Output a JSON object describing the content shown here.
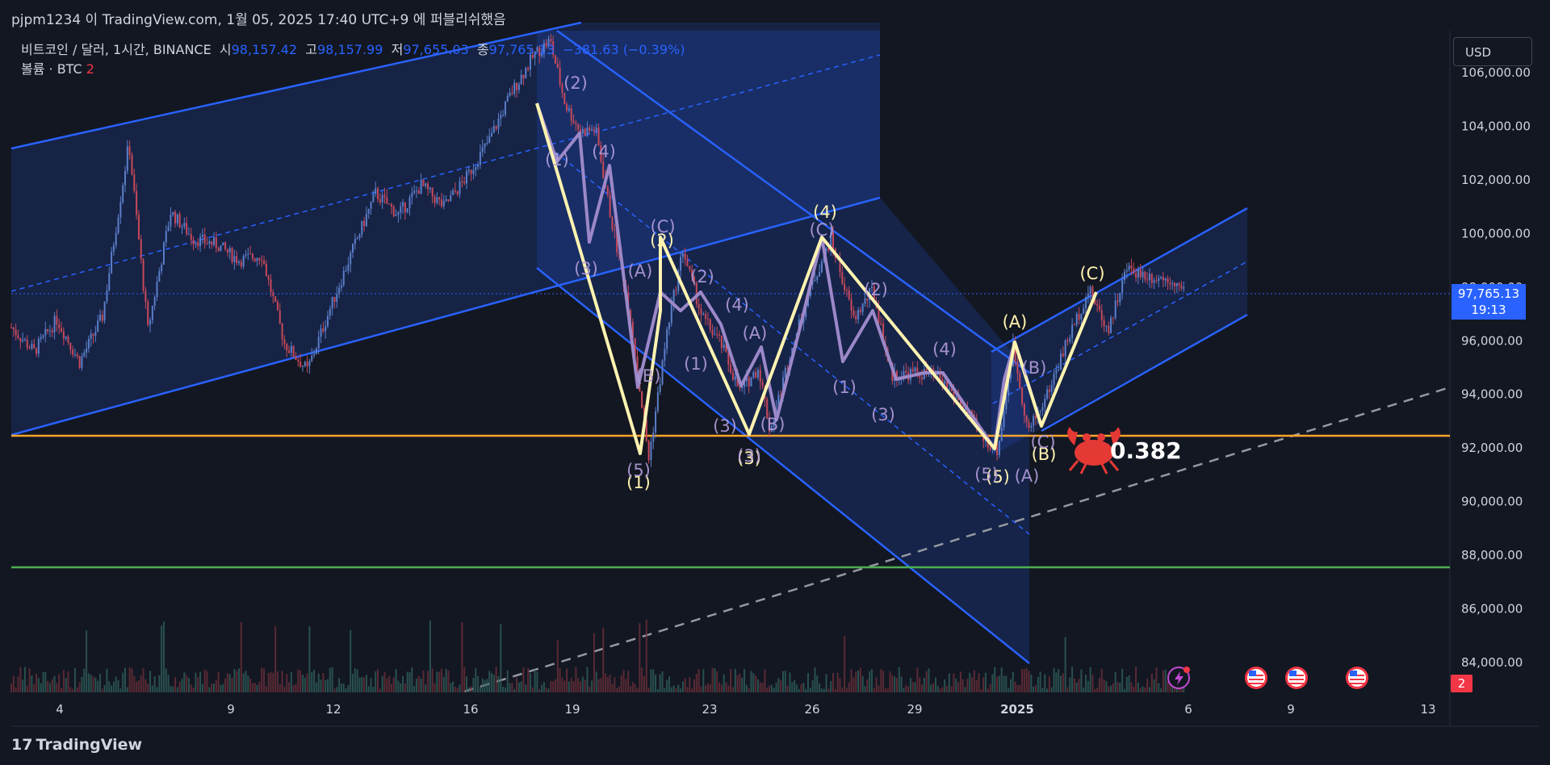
{
  "header": {
    "publish_text": "pjpm1234 이 TradingView.com, 1월 05, 2025 17:40 UTC+9 에 퍼블리쉬했음"
  },
  "legend": {
    "symbol": "비트코인 / 달러, 1시간, BINANCE",
    "open_label": "시",
    "open_value": "98,157.42",
    "high_label": "고",
    "high_value": "98,157.99",
    "low_label": "저",
    "low_value": "97,655.03",
    "close_label": "종",
    "close_value": "97,765.13",
    "change_value": "−381.63 (−0.39%)",
    "volume_label": "볼륨 · BTC",
    "volume_value": "2"
  },
  "currency": "USD",
  "price_tag": {
    "price": "97,765.13",
    "countdown": "19:13"
  },
  "events_count": "2",
  "annotation": {
    "ratio_text": "0.382",
    "crab_icon": "crab-icon"
  },
  "footer": {
    "brand": "TradingView"
  },
  "colors": {
    "background": "#131722",
    "channel_blue": "#2962ff",
    "support_orange": "#f7a42b",
    "support_green": "#4caf50",
    "wave_yellow": "#fff3b0",
    "wave_purple": "#9c88c8",
    "label_purple": "#b39ddb"
  },
  "chart_data": {
    "type": "candlestick",
    "symbol": "BTCUSD",
    "timeframe": "1h",
    "y_ticks": [
      "106,000.00",
      "104,000.00",
      "102,000.00",
      "100,000.00",
      "98,000.00",
      "96,000.00",
      "94,000.00",
      "92,000.00",
      "90,000.00",
      "88,000.00",
      "86,000.00",
      "84,000.00"
    ],
    "x_ticks": [
      "4",
      "9",
      "12",
      "16",
      "19",
      "23",
      "26",
      "29",
      "2025",
      "6",
      "9",
      "13"
    ],
    "last_price": 97765.13,
    "levels": [
      {
        "name": "orange-support",
        "price": 92400,
        "color": "#f7a42b"
      },
      {
        "name": "green-support",
        "price": 87550,
        "color": "#4caf50"
      }
    ],
    "price_path": [
      {
        "t": 0,
        "p": 96500
      },
      {
        "t": 1.2,
        "p": 95600
      },
      {
        "t": 2.4,
        "p": 96800
      },
      {
        "t": 3.6,
        "p": 95200
      },
      {
        "t": 4.8,
        "p": 96900
      },
      {
        "t": 6.2,
        "p": 103400
      },
      {
        "t": 7.2,
        "p": 96400
      },
      {
        "t": 8.4,
        "p": 100800
      },
      {
        "t": 9.6,
        "p": 99800
      },
      {
        "t": 10.8,
        "p": 99600
      },
      {
        "t": 12,
        "p": 99000
      },
      {
        "t": 13.2,
        "p": 99200
      },
      {
        "t": 14.4,
        "p": 95900
      },
      {
        "t": 15.6,
        "p": 94900
      },
      {
        "t": 16.8,
        "p": 97200
      },
      {
        "t": 18,
        "p": 99400
      },
      {
        "t": 19.2,
        "p": 101500
      },
      {
        "t": 20.4,
        "p": 100700
      },
      {
        "t": 21.6,
        "p": 101800
      },
      {
        "t": 22.8,
        "p": 101000
      },
      {
        "t": 24,
        "p": 102100
      },
      {
        "t": 25.2,
        "p": 103500
      },
      {
        "t": 26.4,
        "p": 105300
      },
      {
        "t": 27.6,
        "p": 106700
      },
      {
        "t": 28.4,
        "p": 107200
      },
      {
        "t": 29.2,
        "p": 104800
      },
      {
        "t": 30,
        "p": 103800
      },
      {
        "t": 30.8,
        "p": 103900
      },
      {
        "t": 31.6,
        "p": 100600
      },
      {
        "t": 32.6,
        "p": 97100
      },
      {
        "t": 33.6,
        "p": 91600
      },
      {
        "t": 34.6,
        "p": 96500
      },
      {
        "t": 35.4,
        "p": 99400
      },
      {
        "t": 36.4,
        "p": 96900
      },
      {
        "t": 37.4,
        "p": 95900
      },
      {
        "t": 38.4,
        "p": 94100
      },
      {
        "t": 39.4,
        "p": 95000
      },
      {
        "t": 40,
        "p": 92600
      },
      {
        "t": 41,
        "p": 95400
      },
      {
        "t": 42.2,
        "p": 98100
      },
      {
        "t": 43.2,
        "p": 99800
      },
      {
        "t": 44.4,
        "p": 96800
      },
      {
        "t": 45.4,
        "p": 97900
      },
      {
        "t": 46.4,
        "p": 94700
      },
      {
        "t": 47.6,
        "p": 94800
      },
      {
        "t": 48.8,
        "p": 94700
      },
      {
        "t": 50,
        "p": 93700
      },
      {
        "t": 51.2,
        "p": 92400
      },
      {
        "t": 52,
        "p": 91900
      },
      {
        "t": 52.8,
        "p": 95800
      },
      {
        "t": 53.6,
        "p": 92600
      },
      {
        "t": 54.6,
        "p": 94000
      },
      {
        "t": 55.6,
        "p": 95900
      },
      {
        "t": 56.8,
        "p": 97900
      },
      {
        "t": 57.8,
        "p": 96400
      },
      {
        "t": 58.8,
        "p": 98700
      },
      {
        "t": 60,
        "p": 98400
      },
      {
        "t": 61.2,
        "p": 98300
      },
      {
        "t": 61.8,
        "p": 97765
      }
    ],
    "waves": [
      {
        "label": "(1)",
        "color": "yellow"
      },
      {
        "label": "(2)",
        "color": "yellow"
      },
      {
        "label": "(3)",
        "color": "yellow"
      },
      {
        "label": "(4)",
        "color": "yellow"
      },
      {
        "label": "(5)",
        "color": "yellow"
      },
      {
        "label": "(A)",
        "color": "yellow"
      },
      {
        "label": "(B)",
        "color": "yellow"
      },
      {
        "label": "(C)",
        "color": "yellow"
      }
    ]
  }
}
